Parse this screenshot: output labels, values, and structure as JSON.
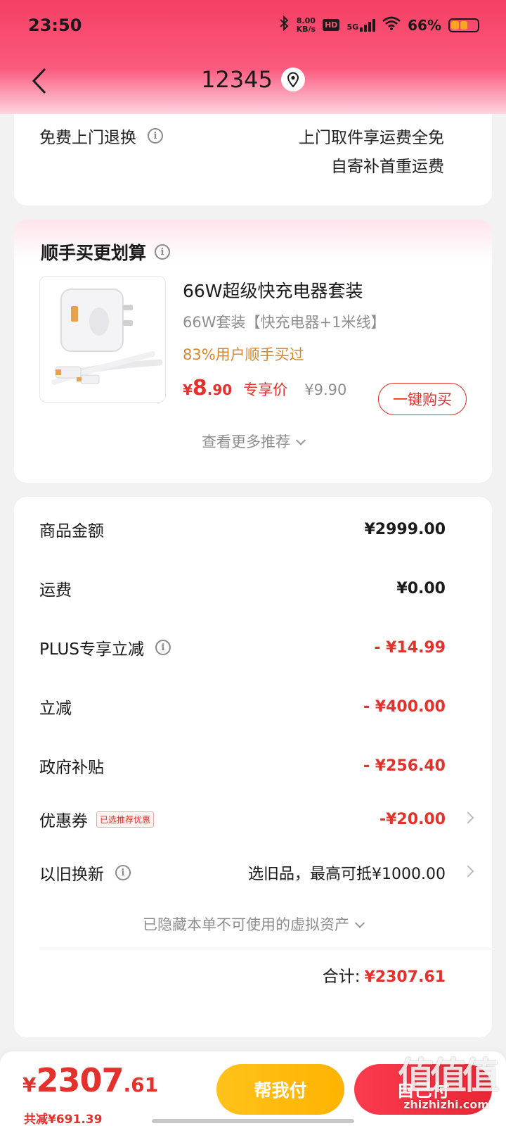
{
  "status_bar": {
    "time": "23:50",
    "net_speed_value": "8.00",
    "net_speed_unit": "KB/s",
    "hd_label": "HD",
    "signal_label": "5G",
    "battery": "66%"
  },
  "nav": {
    "title": "12345"
  },
  "return_policy": {
    "label": "免费上门退换",
    "line1": "上门取件享运费全免",
    "line2": "自寄补首重运费"
  },
  "bundle": {
    "section_title": "顺手买更划算",
    "product_name": "66W超级快充电器套装",
    "product_spec": "66W套装【快充电器+1米线】",
    "social_proof": "83%用户顺手买过",
    "price_yen": "¥",
    "price_int": "8",
    "price_dec": ".90",
    "price_tag": "专享价",
    "original_price": "¥9.90",
    "buy_button": "一键购买",
    "more_link": "查看更多推荐"
  },
  "summary": {
    "rows": [
      {
        "label": "商品金额",
        "value": "¥2999.00"
      },
      {
        "label": "运费",
        "value": "¥0.00"
      },
      {
        "label": "PLUS专享立减",
        "value": "- ¥14.99"
      },
      {
        "label": "立减",
        "value": "- ¥400.00"
      },
      {
        "label": "政府补贴",
        "value": "- ¥256.40"
      },
      {
        "label": "优惠券",
        "value": "-¥20.00",
        "tag": "已选推荐优惠"
      },
      {
        "label": "以旧换新",
        "value": "选旧品，最高可抵¥1000.00"
      }
    ],
    "hidden_assets": "已隐藏本单不可使用的虚拟资产",
    "total_label": "合计:",
    "total_value": "¥2307.61"
  },
  "bottom_bar": {
    "yen": "¥",
    "price_int": "2307",
    "price_dec": ".61",
    "saved": "共减¥691.39",
    "help_pay": "帮我付",
    "self_pay": "自己付"
  },
  "watermark": {
    "main": "值值值",
    "sub": "zhizhizhi.com"
  },
  "colors": {
    "accent_red": "#e4312b",
    "header_pink": "#f43f63",
    "help_yellow": "#ffc21a",
    "social_orange": "#d9872a"
  }
}
